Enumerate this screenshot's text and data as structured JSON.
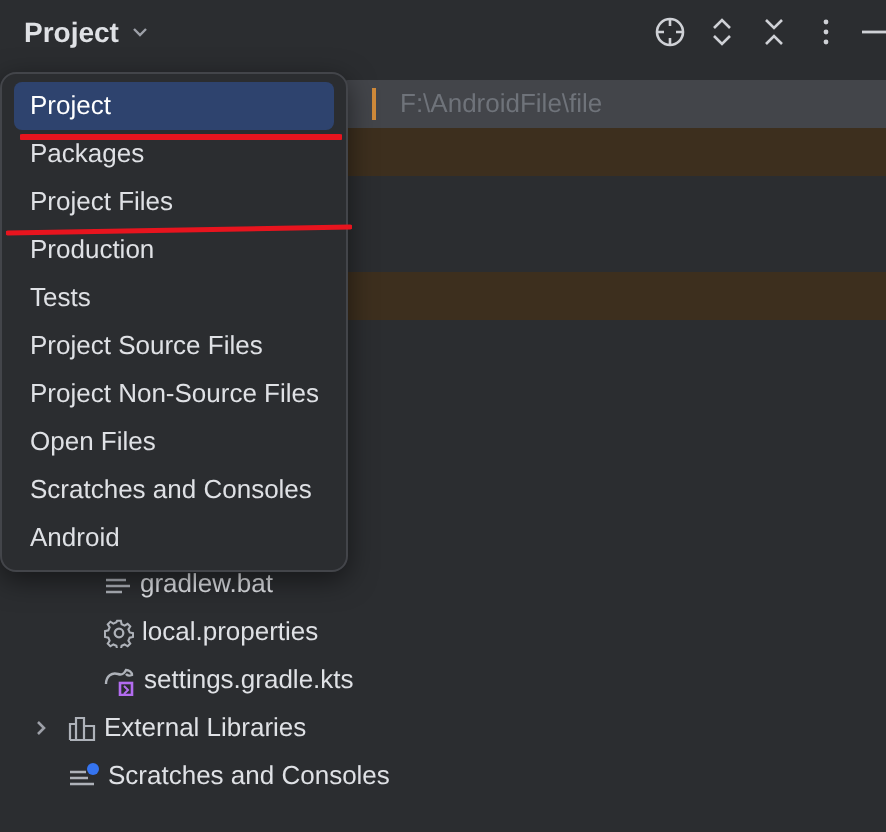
{
  "header": {
    "title": "Project"
  },
  "tree": [
    {
      "kind": "path",
      "label": "F:\\AndroidFile\\file",
      "selected": true,
      "modified": false
    },
    {
      "kind": "blank",
      "selected": false,
      "modified": true
    },
    {
      "kind": "blank",
      "selected": false,
      "modified": false
    },
    {
      "kind": "blank",
      "selected": false,
      "modified": false
    },
    {
      "kind": "blank",
      "selected": false,
      "modified": true
    },
    {
      "kind": "blank",
      "selected": false,
      "modified": false
    },
    {
      "kind": "blank",
      "selected": false,
      "modified": false
    },
    {
      "kind": "blank",
      "selected": false,
      "modified": false
    },
    {
      "kind": "blank",
      "selected": false,
      "modified": false
    },
    {
      "kind": "blank",
      "selected": false,
      "modified": false
    },
    {
      "kind": "text-file",
      "label": "gradlew.bat",
      "selected": false,
      "modified": false
    },
    {
      "kind": "settings-file",
      "label": "local.properties",
      "selected": false,
      "modified": false
    },
    {
      "kind": "gradle-file",
      "label": "settings.gradle.kts",
      "selected": false,
      "modified": false
    },
    {
      "kind": "library",
      "label": "External Libraries",
      "selected": false,
      "modified": false,
      "expanded": false
    },
    {
      "kind": "scratches",
      "label": "Scratches and Consoles",
      "selected": false,
      "modified": false
    }
  ],
  "view_menu": [
    {
      "label": "Project",
      "selected": true
    },
    {
      "label": "Packages",
      "selected": false
    },
    {
      "label": "Project Files",
      "selected": false
    },
    {
      "label": "Production",
      "selected": false
    },
    {
      "label": "Tests",
      "selected": false
    },
    {
      "label": "Project Source Files",
      "selected": false
    },
    {
      "label": "Project Non-Source Files",
      "selected": false
    },
    {
      "label": "Open Files",
      "selected": false
    },
    {
      "label": "Scratches and Consoles",
      "selected": false
    },
    {
      "label": "Android",
      "selected": false
    }
  ]
}
